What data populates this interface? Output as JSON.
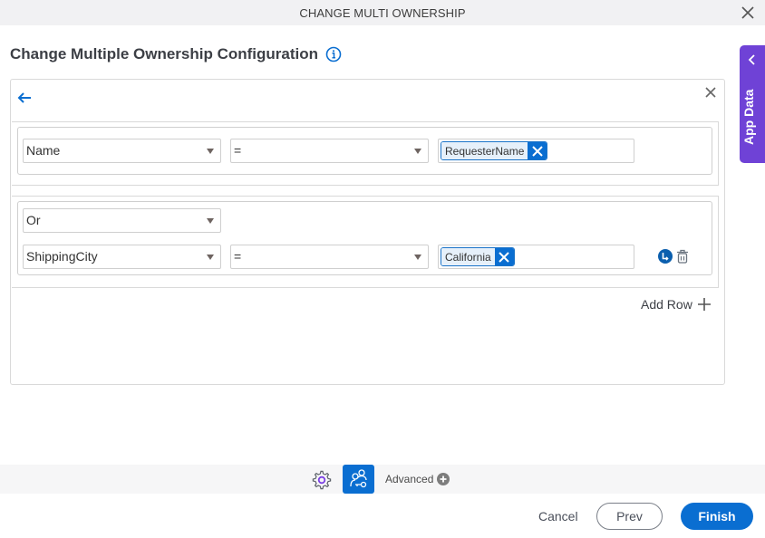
{
  "window": {
    "title": "CHANGE MULTI OWNERSHIP",
    "close_icon": "close-icon"
  },
  "page": {
    "title": "Change Multiple Ownership Configuration",
    "info_icon": "info-icon"
  },
  "app_data_tab": {
    "label": "App Data",
    "icon": "chevron-left-icon"
  },
  "panel": {
    "back_icon": "arrow-left-icon",
    "close_icon": "close-icon",
    "groups": [
      {
        "rows": [
          {
            "field": "Name",
            "operator": "=",
            "value_chip": "RequesterName"
          }
        ]
      },
      {
        "conjunction": "Or",
        "rows": [
          {
            "field": "ShippingCity",
            "operator": "=",
            "value_chip": "California"
          }
        ]
      }
    ],
    "add_row_label": "Add Row"
  },
  "bottom_toolbar": {
    "settings_icon": "gear-icon",
    "roles_icon": "user-key-icon",
    "advanced_label": "Advanced"
  },
  "footer": {
    "cancel_label": "Cancel",
    "prev_label": "Prev",
    "finish_label": "Finish"
  },
  "colors": {
    "primary": "#0a6ed1",
    "app_data_tab": "#6f42d6",
    "titlebar_bg": "#f1f1f3"
  }
}
